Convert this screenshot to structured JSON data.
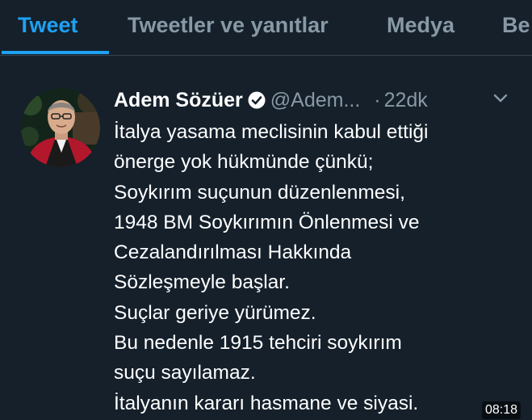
{
  "tabs": [
    {
      "label": "Tweet"
    },
    {
      "label": "Tweetler ve yanıtlar"
    },
    {
      "label": "Medya"
    },
    {
      "label": "Be"
    }
  ],
  "tweet": {
    "display_name": "Adem Sözüer",
    "handle": "@Adem...",
    "separator": "·",
    "time": "22dk",
    "lines": [
      "İtalya yasama meclisinin kabul ettiği",
      "önerge yok hükmünde çünkü;",
      "Soykırım suçunun düzenlenmesi,",
      "1948 BM Soykırımın Önlenmesi ve",
      "Cezalandırılması Hakkında",
      "Sözleşmeyle başlar.",
      "Suçlar geriye yürümez.",
      "Bu nedenle 1915 tehciri soykırım",
      "suçu sayılamaz.",
      "İtalyanın kararı hasmane ve siyasi."
    ]
  },
  "overlay": {
    "video_time": "08:18"
  },
  "colors": {
    "background": "#15202b",
    "accent": "#1da1f2",
    "muted": "#8899a6",
    "divider": "#38444d"
  },
  "icons": {
    "verified": "verified-badge-icon",
    "caret": "chevron-down-icon"
  }
}
